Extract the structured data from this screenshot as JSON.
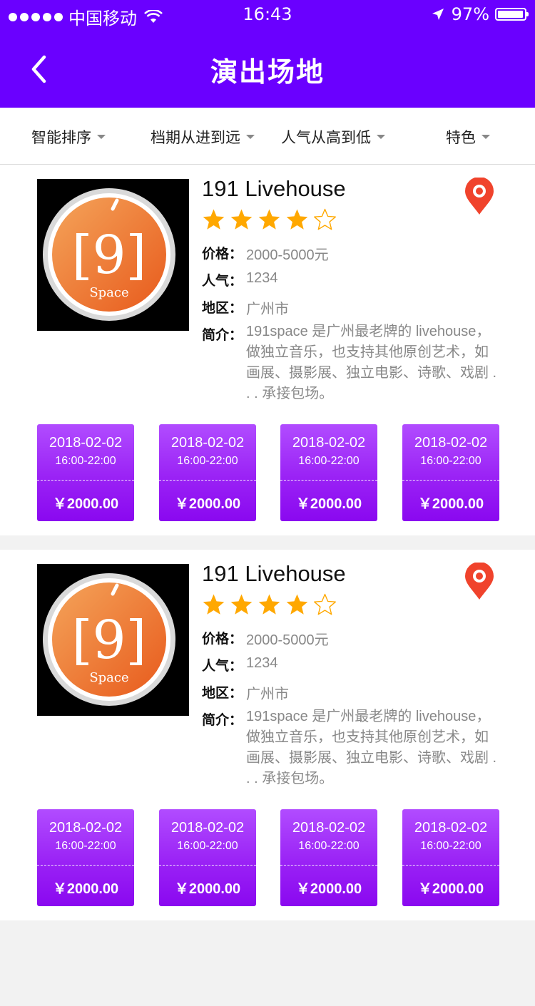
{
  "status_bar": {
    "carrier": "中国移动",
    "time": "16:43",
    "battery": "97%"
  },
  "header": {
    "title": "演出场地"
  },
  "filters": [
    {
      "label": "智能排序"
    },
    {
      "label": "档期从进到远"
    },
    {
      "label": "人气从高到低"
    },
    {
      "label": "特色"
    }
  ],
  "labels": {
    "price": "价格：",
    "popularity": "人气：",
    "region": "地区：",
    "intro": "简介："
  },
  "venues": [
    {
      "name": "191 Livehouse",
      "rating": 4,
      "rating_max": 5,
      "price": "2000-5000元",
      "popularity": "1234",
      "region": "广州市",
      "intro": "191space 是广州最老牌的 livehouse，做独立音乐，也支持其他原创艺术，如画展、摄影展、独立电影、诗歌、戏剧 . . . 承接包场。",
      "logo_text": "Space",
      "slots": [
        {
          "date": "2018-02-02",
          "time": "16:00-22:00",
          "price": "￥2000.00"
        },
        {
          "date": "2018-02-02",
          "time": "16:00-22:00",
          "price": "￥2000.00"
        },
        {
          "date": "2018-02-02",
          "time": "16:00-22:00",
          "price": "￥2000.00"
        },
        {
          "date": "2018-02-02",
          "time": "16:00-22:00",
          "price": "￥2000.00"
        }
      ]
    },
    {
      "name": "191 Livehouse",
      "rating": 4,
      "rating_max": 5,
      "price": "2000-5000元",
      "popularity": "1234",
      "region": "广州市",
      "intro": "191space 是广州最老牌的 livehouse，做独立音乐，也支持其他原创艺术，如画展、摄影展、独立电影、诗歌、戏剧 . . . 承接包场。",
      "logo_text": "Space",
      "slots": [
        {
          "date": "2018-02-02",
          "time": "16:00-22:00",
          "price": "￥2000.00"
        },
        {
          "date": "2018-02-02",
          "time": "16:00-22:00",
          "price": "￥2000.00"
        },
        {
          "date": "2018-02-02",
          "time": "16:00-22:00",
          "price": "￥2000.00"
        },
        {
          "date": "2018-02-02",
          "time": "16:00-22:00",
          "price": "￥2000.00"
        }
      ]
    }
  ],
  "colors": {
    "header": "#6a00ff",
    "star": "#ffa800",
    "pin": "#f0432c",
    "slot": "#9a22f5",
    "logo_orange": "#ee6b25"
  }
}
